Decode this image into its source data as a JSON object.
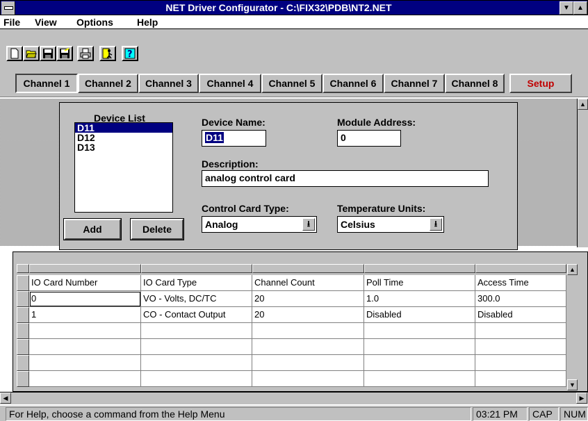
{
  "window": {
    "title": "NET Driver Configurator - C:\\FIX32\\PDB\\NT2.NET",
    "minimize": "▼",
    "maximize": "▲"
  },
  "menu": {
    "file": "File",
    "view": "View",
    "options": "Options",
    "help": "Help"
  },
  "toolbar": {
    "icons": [
      "new-file-icon",
      "open-folder-icon",
      "save-icon",
      "save-all-icon",
      "print-icon",
      "exit-icon",
      "help-icon"
    ]
  },
  "tabs": [
    "Channel 1",
    "Channel 2",
    "Channel 3",
    "Channel 4",
    "Channel 5",
    "Channel 6",
    "Channel 7",
    "Channel 8"
  ],
  "setup_label": "Setup",
  "device": {
    "list_label": "Device List",
    "items": [
      "D11",
      "D12",
      "D13"
    ],
    "selected": "D11",
    "add_label": "Add",
    "delete_label": "Delete",
    "name_label": "Device Name:",
    "name_value": "D11",
    "module_label": "Module Address:",
    "module_value": "0",
    "description_label": "Description:",
    "description_value": "analog control card",
    "control_label": "Control Card Type:",
    "control_value": "Analog",
    "temp_label": "Temperature Units:",
    "temp_value": "Celsius"
  },
  "grid": {
    "columns": [
      "IO Card Number",
      "IO Card Type",
      "Channel Count",
      "Poll Time",
      "Access Time"
    ],
    "rows": [
      [
        "0",
        "VO - Volts, DC/TC",
        "20",
        "1.0",
        "300.0"
      ],
      [
        "1",
        "CO - Contact Output",
        "20",
        "Disabled",
        "Disabled"
      ]
    ]
  },
  "status": {
    "message": "For Help, choose a command from the Help Menu",
    "time": "03:21 PM",
    "cap": "CAP",
    "num": "NUM"
  },
  "colors": {
    "titlebar": "#000080",
    "face": "#c0c0c0",
    "selection": "#000080",
    "setup_text": "#c00000"
  }
}
